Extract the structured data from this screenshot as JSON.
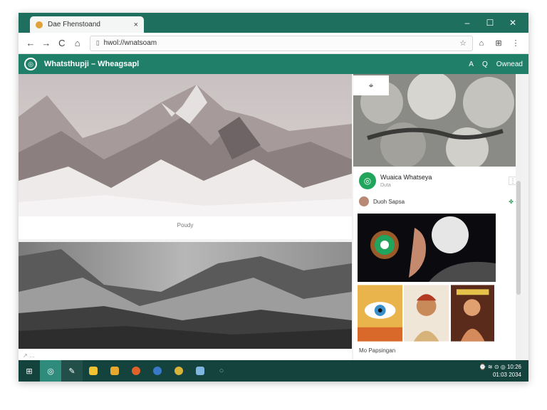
{
  "browser": {
    "tab_title": "Dae Fhenstoand",
    "close_glyph": "×",
    "window_controls": [
      "–",
      "☐",
      "✕"
    ],
    "url": "hwol://wnatsoam",
    "back_glyph": "←",
    "forward_glyph": "→",
    "reload_glyph": "C",
    "home_glyph": "⌂",
    "secure_glyph": "▯",
    "bookmark_glyph": "☆",
    "menu_glyphs": [
      "⌂",
      "⊞",
      "⋮"
    ]
  },
  "app": {
    "logo_glyph": "◎",
    "title": "Whatsthupji – Wheagsapl",
    "actions": [
      "A",
      "Q",
      "Ownead"
    ]
  },
  "feed": {
    "card1_caption": "Poudy",
    "card2_footer": "↗ …",
    "hero_button_glyph": "⌖"
  },
  "channel": {
    "name": "Wuaica Whatseya",
    "subtitle": "Duta",
    "menu_glyph": "⋮",
    "user_name": "Duoh Sapsa",
    "user_actions": "✤ •",
    "footer": "Mo Papsingan"
  },
  "taskbar": {
    "start_glyph": "⊞",
    "clock": "⌚ ≋ ⊙ ◎ 10:26\n01:03 2034"
  },
  "colors": {
    "titlebar": "#1e6f5e",
    "appbar": "#1f7f69",
    "taskbar": "#14423d",
    "accent_green": "#21a45b"
  }
}
